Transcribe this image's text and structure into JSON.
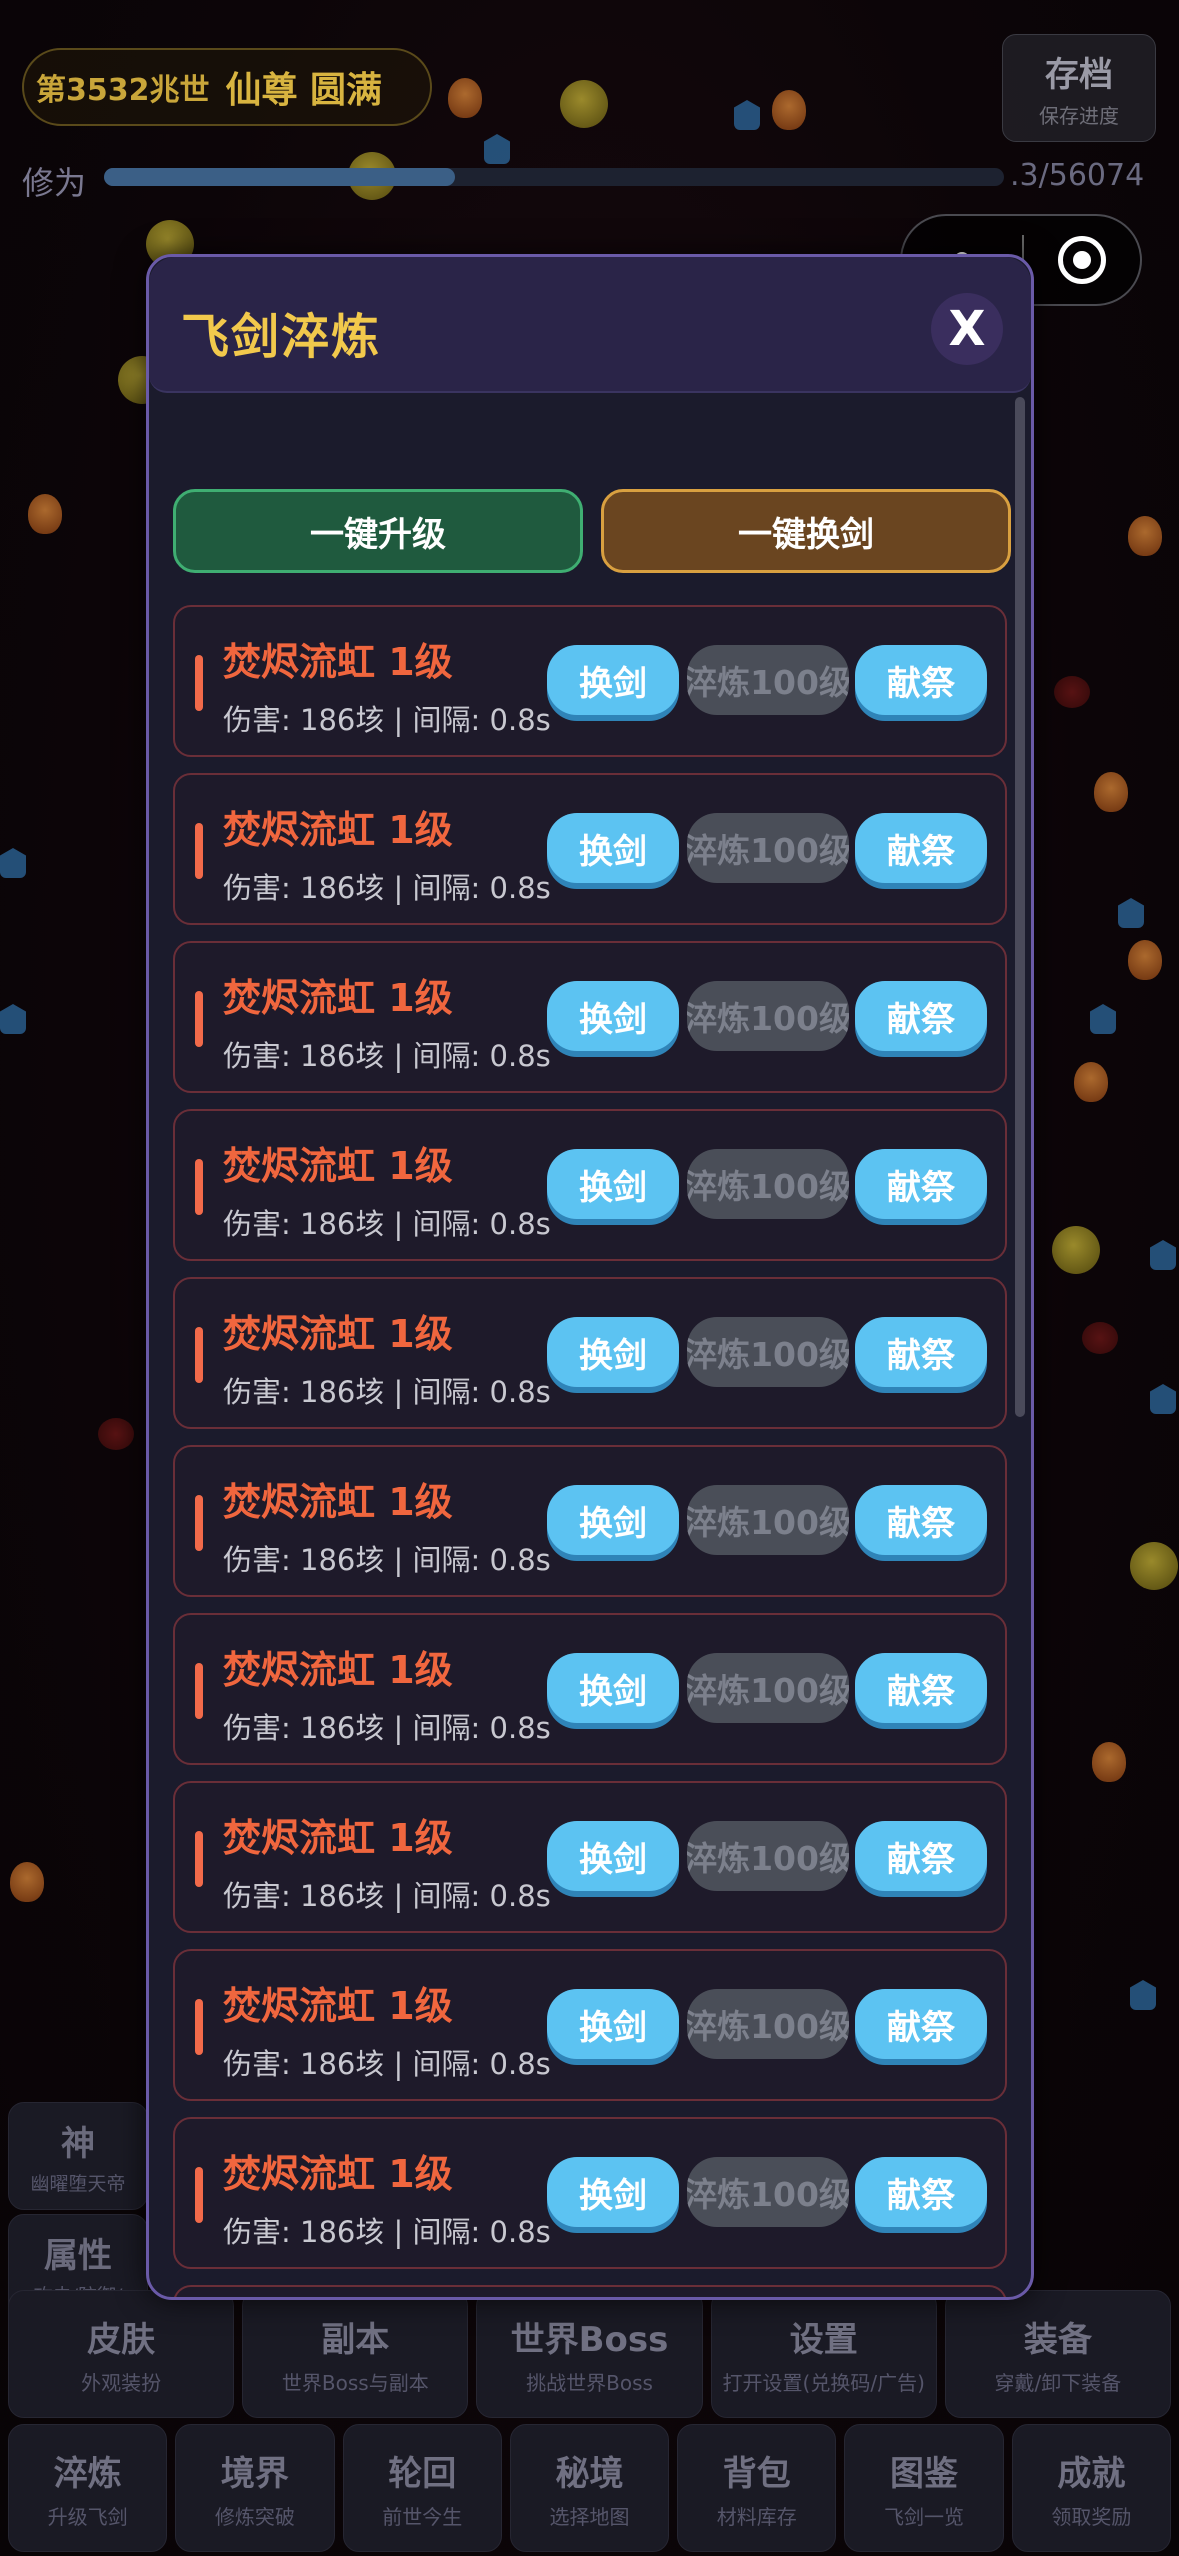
{
  "hud": {
    "generation": "第3532兆世",
    "rank": "仙尊 圆满",
    "xiuwei_label": "修为",
    "xiuwei_value": ".3/56074",
    "xiuwei_progress": 0.39,
    "save_title": "存档",
    "save_sub": "保存进度"
  },
  "modal": {
    "title": "飞剑淬炼",
    "close_label": "X",
    "upgrade_all": "一键升级",
    "swap_all": "一键换剑",
    "swords": [
      {
        "name": "焚烬流虹 1级",
        "stat": "伤害: 186垓 | 间隔: 0.8s",
        "swap": "换剑",
        "refine": "淬炼100级",
        "offer": "献祭"
      },
      {
        "name": "焚烬流虹 1级",
        "stat": "伤害: 186垓 | 间隔: 0.8s",
        "swap": "换剑",
        "refine": "淬炼100级",
        "offer": "献祭"
      },
      {
        "name": "焚烬流虹 1级",
        "stat": "伤害: 186垓 | 间隔: 0.8s",
        "swap": "换剑",
        "refine": "淬炼100级",
        "offer": "献祭"
      },
      {
        "name": "焚烬流虹 1级",
        "stat": "伤害: 186垓 | 间隔: 0.8s",
        "swap": "换剑",
        "refine": "淬炼100级",
        "offer": "献祭"
      },
      {
        "name": "焚烬流虹 1级",
        "stat": "伤害: 186垓 | 间隔: 0.8s",
        "swap": "换剑",
        "refine": "淬炼100级",
        "offer": "献祭"
      },
      {
        "name": "焚烬流虹 1级",
        "stat": "伤害: 186垓 | 间隔: 0.8s",
        "swap": "换剑",
        "refine": "淬炼100级",
        "offer": "献祭"
      },
      {
        "name": "焚烬流虹 1级",
        "stat": "伤害: 186垓 | 间隔: 0.8s",
        "swap": "换剑",
        "refine": "淬炼100级",
        "offer": "献祭"
      },
      {
        "name": "焚烬流虹 1级",
        "stat": "伤害: 186垓 | 间隔: 0.8s",
        "swap": "换剑",
        "refine": "淬炼100级",
        "offer": "献祭"
      },
      {
        "name": "焚烬流虹 1级",
        "stat": "伤害: 186垓 | 间隔: 0.8s",
        "swap": "换剑",
        "refine": "淬炼100级",
        "offer": "献祭"
      },
      {
        "name": "焚烬流虹 1级",
        "stat": "伤害: 186垓 | 间隔: 0.8s",
        "swap": "换剑",
        "refine": "淬炼100级",
        "offer": "献祭"
      }
    ]
  },
  "side_cards": [
    {
      "title": "神",
      "sub": "幽曜堕天帝"
    },
    {
      "title": "属性",
      "sub": "攻击/防御/"
    }
  ],
  "menu_row1": [
    {
      "title": "皮肤",
      "sub": "外观装扮"
    },
    {
      "title": "副本",
      "sub": "世界Boss与副本"
    },
    {
      "title": "世界Boss",
      "sub": "挑战世界Boss"
    },
    {
      "title": "设置",
      "sub": "打开设置(兑换码/广告)"
    },
    {
      "title": "装备",
      "sub": "穿戴/卸下装备"
    }
  ],
  "menu_row2": [
    {
      "title": "淬炼",
      "sub": "升级飞剑"
    },
    {
      "title": "境界",
      "sub": "修炼突破"
    },
    {
      "title": "轮回",
      "sub": "前世今生"
    },
    {
      "title": "秘境",
      "sub": "选择地图"
    },
    {
      "title": "背包",
      "sub": "材料库存"
    },
    {
      "title": "图鉴",
      "sub": "飞剑一览"
    },
    {
      "title": "成就",
      "sub": "领取奖励"
    }
  ],
  "colors": {
    "title_gold": "#f2c94c",
    "sword_name": "#f0663e",
    "button_blue": "#5cc3f2",
    "modal_border": "#6a5aa8"
  },
  "icons": [
    "more-dots-icon",
    "target-home-icon",
    "close-icon"
  ]
}
